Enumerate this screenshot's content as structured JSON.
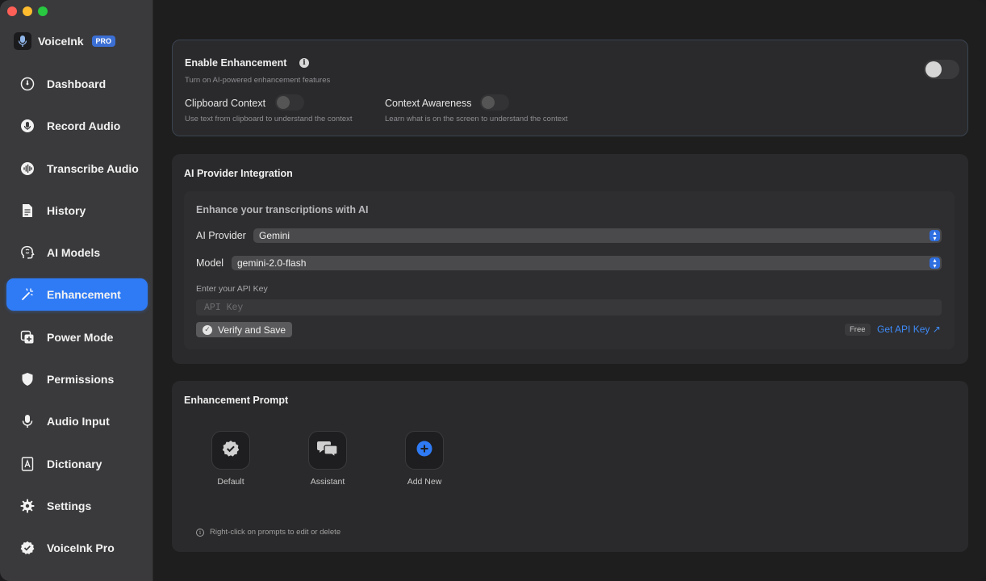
{
  "app": {
    "name": "VoiceInk",
    "badge": "PRO"
  },
  "colors": {
    "accent": "#2f7bf5",
    "link": "#3e8af7",
    "sidebar": "#3a3a3c",
    "card": "#2a2a2c"
  },
  "sidebar": {
    "items": [
      {
        "label": "Dashboard",
        "icon": "gauge-icon"
      },
      {
        "label": "Record Audio",
        "icon": "waveform-mic-icon"
      },
      {
        "label": "Transcribe Audio",
        "icon": "waveform-icon"
      },
      {
        "label": "History",
        "icon": "document-icon"
      },
      {
        "label": "AI Models",
        "icon": "brain-head-icon"
      },
      {
        "label": "Enhancement",
        "icon": "magic-wand-icon",
        "active": true
      },
      {
        "label": "Power Mode",
        "icon": "add-square-icon"
      },
      {
        "label": "Permissions",
        "icon": "shield-icon"
      },
      {
        "label": "Audio Input",
        "icon": "mic-icon"
      },
      {
        "label": "Dictionary",
        "icon": "book-icon"
      },
      {
        "label": "Settings",
        "icon": "gear-icon"
      },
      {
        "label": "VoiceInk Pro",
        "icon": "checkmark-seal-icon"
      }
    ]
  },
  "enhancement": {
    "title": "Enable Enhancement",
    "subtitle": "Turn on AI-powered enhancement features",
    "enabled": false,
    "clipboard": {
      "label": "Clipboard Context",
      "desc": "Use text from clipboard to understand the context",
      "enabled": false
    },
    "context": {
      "label": "Context Awareness",
      "desc": "Learn what is on the screen to understand the context",
      "enabled": false
    }
  },
  "provider": {
    "section_title": "AI Provider Integration",
    "heading": "Enhance your transcriptions with AI",
    "provider_label": "AI Provider",
    "provider_value": "Gemini",
    "model_label": "Model",
    "model_value": "gemini-2.0-flash",
    "api_key_label": "Enter your API Key",
    "api_key_placeholder": "API Key",
    "api_key_value": "",
    "verify_label": "Verify and Save",
    "free_badge": "Free",
    "get_key_label": "Get API Key ↗"
  },
  "prompts": {
    "section_title": "Enhancement Prompt",
    "items": [
      {
        "label": "Default",
        "icon": "checkmark-seal-icon"
      },
      {
        "label": "Assistant",
        "icon": "chat-bubbles-icon"
      },
      {
        "label": "Add New",
        "icon": "plus-circle-icon"
      }
    ],
    "footnote": "Right-click on prompts to edit or delete"
  }
}
